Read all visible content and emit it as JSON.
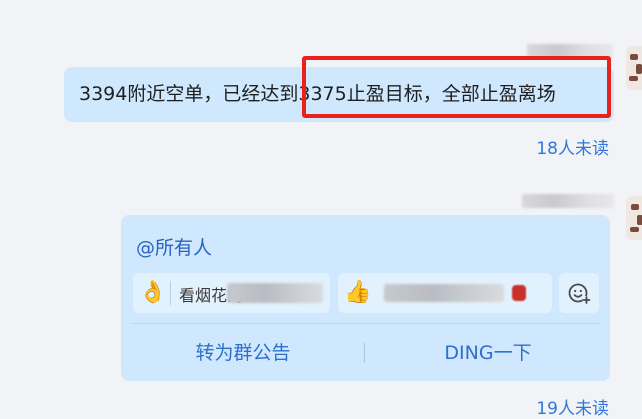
{
  "messages": [
    {
      "text": "3394附近空单，已经达到3375止盈目标，全部止盈离场",
      "read_status": "18人未读"
    },
    {
      "mention": "@所有人",
      "reactions": [
        {
          "emoji": "👌",
          "label": "看烟花的"
        },
        {
          "emoji": "👍",
          "label": ""
        }
      ],
      "actions": {
        "announce": "转为群公告",
        "ding": "DING一下"
      },
      "read_status": "19人未读"
    }
  ],
  "colors": {
    "bubble": "#cfe8fd",
    "highlight": "#e8221b",
    "link": "#3276d9"
  },
  "icons": {
    "add_reaction": "emoji-plus-icon"
  }
}
